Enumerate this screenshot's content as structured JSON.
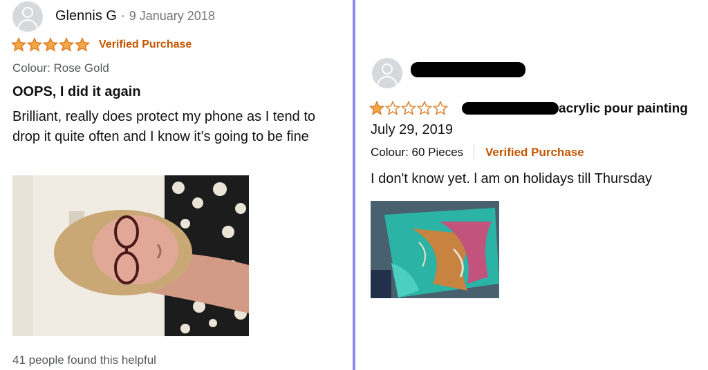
{
  "left_review": {
    "reviewer_name": "Glennis G",
    "separator": "·",
    "date": "9 January 2018",
    "rating": 5,
    "verified_label": "Verified Purchase",
    "colour_label": "Colour: Rose Gold",
    "title": "OOPS, I did it again",
    "body": "Brilliant, really does protect my phone as I tend to drop it quite often and I know it’s going to be fine",
    "helpful_text": "41 people found this helpful"
  },
  "right_review": {
    "rating": 1,
    "title_fragment": "acrylic pour painting",
    "date": "July 29, 2019",
    "colour_label": "Colour: 60 Pieces",
    "verified_label": "Verified Purchase",
    "body": "I don't know yet. l am on holidays till Thursday"
  },
  "colors": {
    "star": "#f3a847",
    "star_outline": "#de7921",
    "verified": "#c45500",
    "divider": "#8b87f0"
  }
}
